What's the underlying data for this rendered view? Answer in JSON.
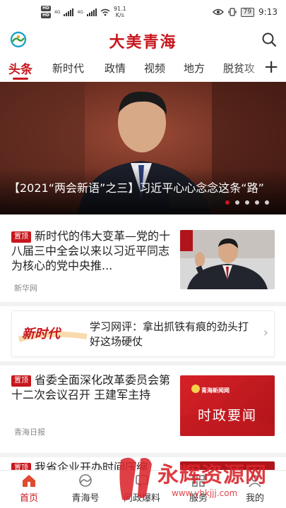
{
  "status_bar": {
    "sim1": "HD",
    "sim2": "HD",
    "net1": "4G",
    "net2": "4G",
    "speed_value": "91.1",
    "speed_unit": "K/s",
    "battery": "79",
    "time": "9:13"
  },
  "header": {
    "title": "大美青海"
  },
  "tabs": [
    {
      "label": "头条",
      "active": true
    },
    {
      "label": "新时代"
    },
    {
      "label": "政情"
    },
    {
      "label": "视频"
    },
    {
      "label": "地方"
    },
    {
      "label": "脱贫攻"
    }
  ],
  "hero": {
    "caption": "【2021“两会新语”之三】习近平心心念念这条“路”",
    "slide_count": 5,
    "active_slide": 1
  },
  "news": [
    {
      "badge": "置顶",
      "title": "新时代的伟大变革—党的十八届三中全会以来以习近平同志为核心的党中央推...",
      "source": "新华网"
    },
    {
      "badge": "置顶",
      "title": "省委全面深化改革委员会第十二次会议召开 王建军主持",
      "source": "青海日报",
      "thumb_header": "青海新闻网",
      "thumb_title": "时政要闻"
    },
    {
      "badge": "置顶",
      "title": "我省企业开办时间压缩"
    }
  ],
  "featured": {
    "image_text": "新时代",
    "title": "学习网评：拿出抓铁有痕的劲头打好这场硬仗"
  },
  "bottom_nav": [
    {
      "label": "首页",
      "icon": "home-icon",
      "active": true
    },
    {
      "label": "青海号",
      "icon": "qinghai-logo-icon"
    },
    {
      "label": "问政爆料",
      "icon": "report-icon"
    },
    {
      "label": "服务",
      "icon": "service-icon"
    },
    {
      "label": "我的",
      "icon": "profile-icon"
    }
  ],
  "watermark": {
    "text": "永辉资源网",
    "url": "www.yhkjjj.com"
  },
  "colors": {
    "accent": "#c8161d",
    "muted": "#888888"
  }
}
